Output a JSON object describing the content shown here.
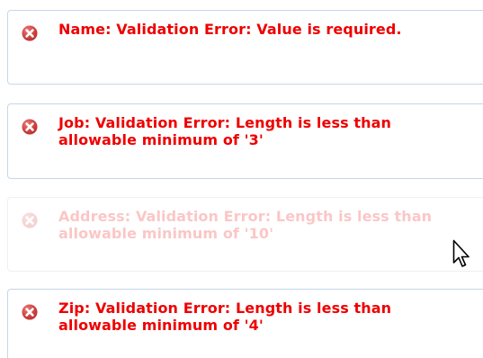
{
  "colors": {
    "error_text": "#ee0000",
    "error_icon": "#cc3333",
    "border": "#c6d6ea"
  },
  "messages": [
    {
      "icon": "error-icon",
      "text": "Name: Validation Error: Value is required.",
      "faded": false
    },
    {
      "icon": "error-icon",
      "text": "Job: Validation Error: Length is less than allowable minimum of '3'",
      "faded": false
    },
    {
      "icon": "error-icon",
      "text": "Address: Validation Error: Length is less than allowable minimum of '10'",
      "faded": true
    },
    {
      "icon": "error-icon",
      "text": "Zip: Validation Error: Length is less than allowable minimum of '4'",
      "faded": false
    }
  ],
  "cursor": {
    "icon": "mouse-pointer-icon"
  }
}
